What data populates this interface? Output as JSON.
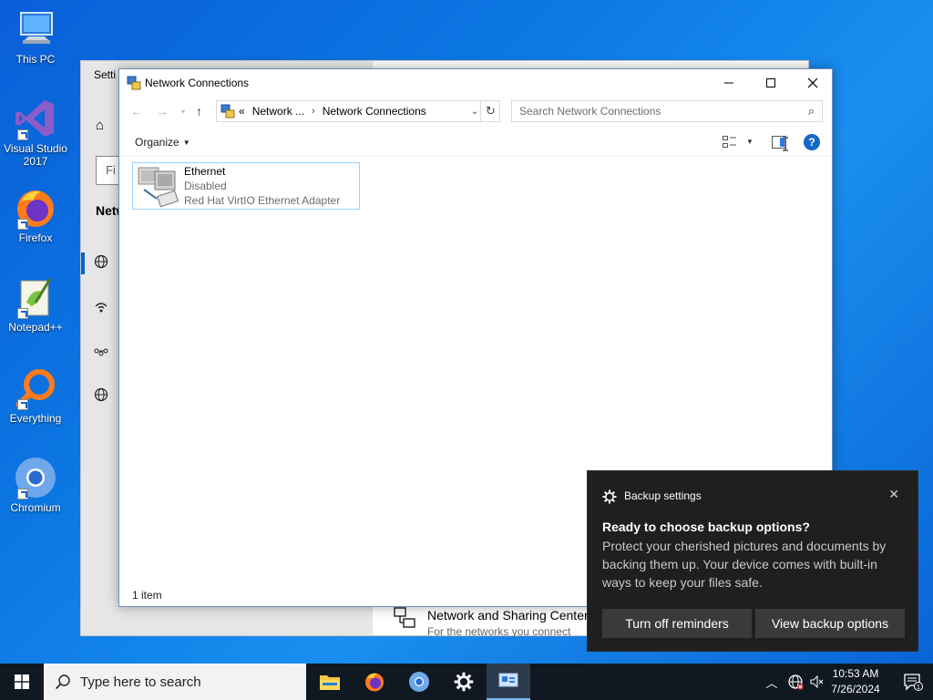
{
  "desktop": {
    "icons": [
      {
        "label": "This PC",
        "icon": "this-pc-icon"
      },
      {
        "label": "Visual Studio 2017",
        "icon": "visual-studio-icon"
      },
      {
        "label": "Firefox",
        "icon": "firefox-icon"
      },
      {
        "label": "Notepad++",
        "icon": "notepad-plus-plus-icon"
      },
      {
        "label": "Everything",
        "icon": "everything-icon"
      },
      {
        "label": "Chromium",
        "icon": "chromium-icon"
      }
    ]
  },
  "settings_window": {
    "title_fragment": "Setti",
    "find_placeholder_fragment": "Fi",
    "heading_fragment": "Netw",
    "network_sharing_center": {
      "title": "Network and Sharing Center",
      "desc": "For the networks you connect"
    }
  },
  "explorer": {
    "title": "Network Connections",
    "address": {
      "overflow": "«",
      "segments": [
        "Network ...",
        "Network Connections"
      ]
    },
    "search_placeholder": "Search Network Connections",
    "organize_label": "Organize",
    "items": [
      {
        "name": "Ethernet",
        "status": "Disabled",
        "device": "Red Hat VirtIO Ethernet Adapter"
      }
    ],
    "status_text": "1 item"
  },
  "toast": {
    "app_name": "Backup settings",
    "heading": "Ready to choose backup options?",
    "body": "Protect your cherished pictures and documents by backing them up. Your device comes with built-in ways to keep your files safe.",
    "buttons": [
      "Turn off reminders",
      "View backup options"
    ]
  },
  "taskbar": {
    "search_placeholder": "Type here to search",
    "apps": [
      "file-explorer-icon",
      "firefox-icon",
      "chromium-icon",
      "settings-gear-icon",
      "network-connections-icon"
    ],
    "clock_time": "10:53 AM",
    "clock_date": "7/26/2024",
    "notification_count": "1"
  },
  "colors": {
    "desktop_blue": "#0b78e3",
    "selection_border": "#99d1ff",
    "toast_bg": "#1f1f1f",
    "taskbar_bg": "#101822",
    "accent": "#0067c0"
  }
}
